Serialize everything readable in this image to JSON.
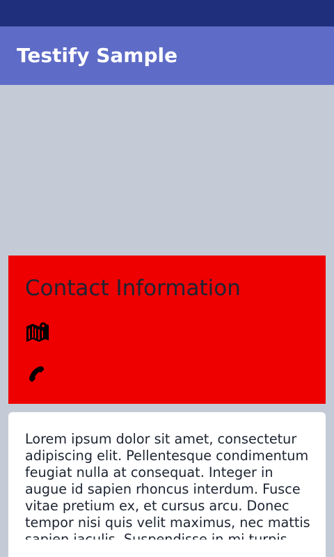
{
  "app_bar": {
    "title": "Testify Sample"
  },
  "contact": {
    "heading": "Contact Information",
    "map_icon": "map-icon",
    "phone_icon": "phone-icon"
  },
  "body": {
    "text": "Lorem ipsum dolor sit amet, consectetur adipiscing elit. Pellentesque condimentum feugiat nulla at consequat. Integer in augue id sapien rhoncus interdum. Fusce vitae pretium ex, et cursus arcu. Donec tempor nisi quis velit maximus, nec mattis sapien iaculis. Suspendisse in mi turpis. Phasellus"
  },
  "colors": {
    "status_bar": "#202f7b",
    "app_bar": "#5f6cc7",
    "background": "#c4cbd6",
    "contact_card": "#ee0000",
    "text_card": "#ffffff"
  }
}
